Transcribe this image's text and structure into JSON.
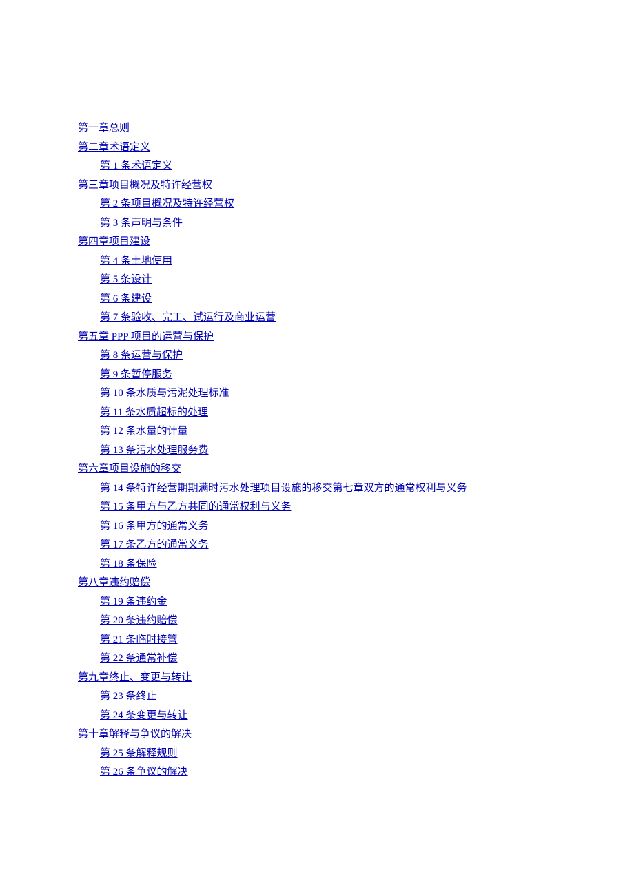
{
  "toc": [
    {
      "level": 0,
      "text": "第一章总则"
    },
    {
      "level": 0,
      "text": "第二章术语定义"
    },
    {
      "level": 1,
      "text": "第 1 条术语定义"
    },
    {
      "level": 0,
      "text": "第三章项目概况及特许经营权"
    },
    {
      "level": 1,
      "text": "第 2 条项目概况及特许经营权"
    },
    {
      "level": 1,
      "text": "第 3 条声明与条件"
    },
    {
      "level": 0,
      "text": "第四章项目建设"
    },
    {
      "level": 1,
      "text": "第 4 条土地使用"
    },
    {
      "level": 1,
      "text": "第 5 条设计"
    },
    {
      "level": 1,
      "text": "第 6 条建设"
    },
    {
      "level": 1,
      "text": "第 7 条验收、完工、试运行及商业运营"
    },
    {
      "level": 0,
      "text": "第五章 PPP 项目的运营与保护"
    },
    {
      "level": 1,
      "text": "第 8 条运营与保护"
    },
    {
      "level": 1,
      "text": "第 9 条暂停服务"
    },
    {
      "level": 1,
      "text": "第 10 条水质与污泥处理标准"
    },
    {
      "level": 1,
      "text": "第 11 条水质超标的处理"
    },
    {
      "level": 1,
      "text": "第 12 条水量的计量"
    },
    {
      "level": 1,
      "text": "第 13 条污水处理服务费"
    },
    {
      "level": 0,
      "text": "第六章项目设施的移交"
    },
    {
      "level": 1,
      "text": "第 14 条特许经营期期满时污水处理项目设施的移交",
      "extra": "第七章双方的通常权利与义务"
    },
    {
      "level": 1,
      "text": "第 15 条甲方与乙方共同的通常权利与义务"
    },
    {
      "level": 1,
      "text": "第 16 条甲方的通常义务"
    },
    {
      "level": 1,
      "text": "第 17 条乙方的通常义务"
    },
    {
      "level": 1,
      "text": "第 18 条保险"
    },
    {
      "level": 0,
      "text": "第八章违约赔偿"
    },
    {
      "level": 1,
      "text": "第 19 条违约金"
    },
    {
      "level": 1,
      "text": "第 20 条违约赔偿"
    },
    {
      "level": 1,
      "text": "第 21 条临时接管"
    },
    {
      "level": 1,
      "text": "第 22 条通常补偿"
    },
    {
      "level": 0,
      "text": "第九章终止、变更与转让"
    },
    {
      "level": 1,
      "text": "第 23 条终止"
    },
    {
      "level": 1,
      "text": "第 24 条变更与转让"
    },
    {
      "level": 0,
      "text": "第十章解释与争议的解决"
    },
    {
      "level": 1,
      "text": "第 25 条解释规则"
    },
    {
      "level": 1,
      "text": "第 26 条争议的解决"
    }
  ]
}
